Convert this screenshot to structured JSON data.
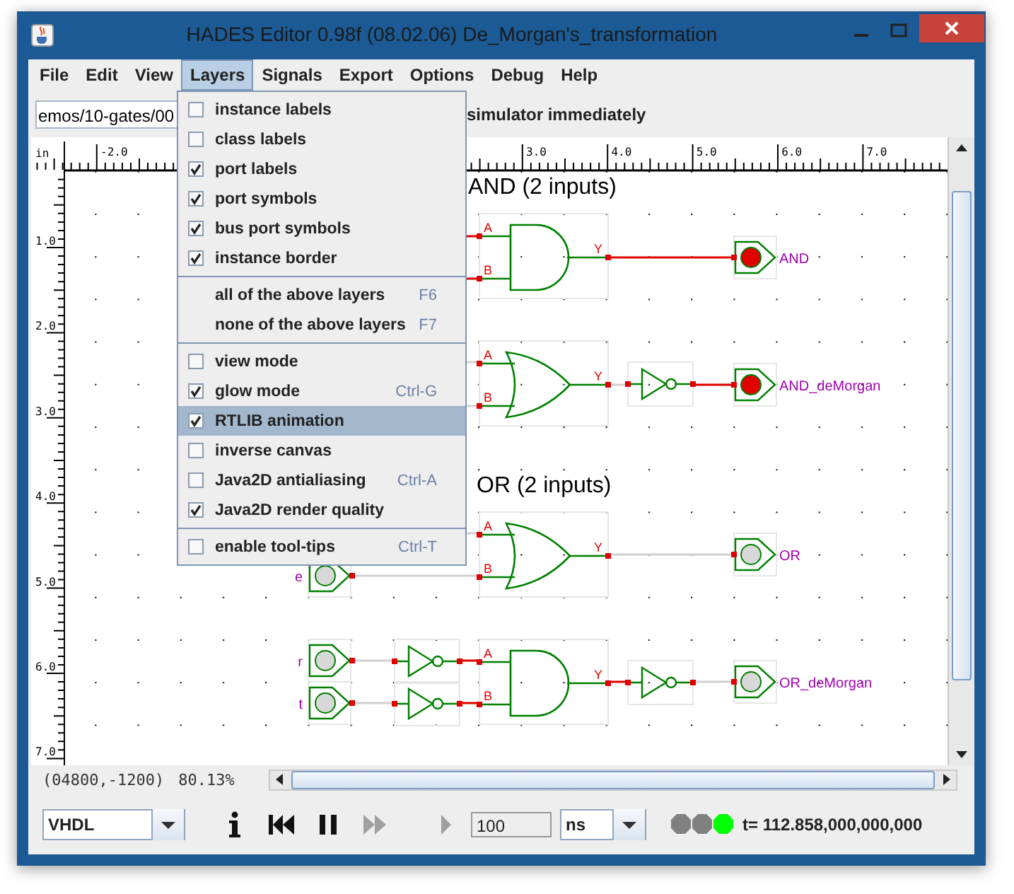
{
  "window": {
    "title": "HADES Editor 0.98f (08.02.06)   De_Morgan's_transformation"
  },
  "menu_bar": [
    {
      "label": "File",
      "selected": false
    },
    {
      "label": "Edit",
      "selected": false
    },
    {
      "label": "View",
      "selected": false
    },
    {
      "label": "Layers",
      "selected": true
    },
    {
      "label": "Signals",
      "selected": false
    },
    {
      "label": "Export",
      "selected": false
    },
    {
      "label": "Options",
      "selected": false
    },
    {
      "label": "Debug",
      "selected": false
    },
    {
      "label": "Help",
      "selected": false
    }
  ],
  "toolbar": {
    "path": "emos/10-gates/00",
    "message": "simulator immediately"
  },
  "layers_menu": [
    [
      {
        "kind": "check",
        "label": "instance labels",
        "checked": false,
        "selected": false
      },
      {
        "kind": "check",
        "label": "class labels",
        "checked": false,
        "selected": false
      },
      {
        "kind": "check",
        "label": "port labels",
        "checked": true,
        "selected": false
      },
      {
        "kind": "check",
        "label": "port symbols",
        "checked": true,
        "selected": false
      },
      {
        "kind": "check",
        "label": "bus port symbols",
        "checked": true,
        "selected": false
      },
      {
        "kind": "check",
        "label": "instance border",
        "checked": true,
        "selected": false
      }
    ],
    [
      {
        "kind": "action",
        "label": "all of the above layers",
        "shortcut": "F6",
        "selected": false
      },
      {
        "kind": "action",
        "label": "none of the above layers",
        "shortcut": "F7",
        "selected": false
      }
    ],
    [
      {
        "kind": "check",
        "label": "view mode",
        "checked": false,
        "selected": false
      },
      {
        "kind": "check",
        "label": "glow mode",
        "checked": true,
        "shortcut": "Ctrl-G",
        "selected": false
      },
      {
        "kind": "check",
        "label": "RTLIB animation",
        "checked": true,
        "selected": true
      },
      {
        "kind": "check",
        "label": "inverse canvas",
        "checked": false,
        "selected": false
      },
      {
        "kind": "check",
        "label": "Java2D antialiasing",
        "checked": false,
        "shortcut": "Ctrl-A",
        "selected": false
      },
      {
        "kind": "check",
        "label": "Java2D render quality",
        "checked": true,
        "selected": false
      }
    ],
    [
      {
        "kind": "check",
        "label": "enable tool-tips",
        "checked": false,
        "shortcut": "Ctrl-T",
        "selected": false
      }
    ]
  ],
  "canvas": {
    "ruler_unit": "in",
    "top_ruler": [
      "-2.0",
      "3.0",
      "4.0",
      "5.0",
      "6.0",
      "7.0"
    ],
    "left_ruler": [
      "1.0",
      "2.0",
      "3.0",
      "4.0",
      "5.0",
      "6.0",
      "7.0"
    ],
    "titles": [
      "AND (2 inputs)",
      "OR (2 inputs)"
    ],
    "gates": [
      {
        "kind": "and",
        "ports": [
          "A",
          "B",
          "Y"
        ]
      },
      {
        "kind": "or",
        "ports": [
          "A",
          "B",
          "Y"
        ]
      },
      {
        "kind": "or",
        "ports": [
          "A",
          "B",
          "Y"
        ]
      },
      {
        "kind": "and",
        "ports": [
          "A",
          "B",
          "Y"
        ]
      }
    ],
    "inputs": [
      {
        "label": "e",
        "on": false
      },
      {
        "label": "r",
        "on": false
      },
      {
        "label": "t",
        "on": false
      }
    ],
    "outputs": [
      {
        "label": "AND",
        "on": true
      },
      {
        "label": "AND_deMorgan",
        "on": true
      },
      {
        "label": "OR",
        "on": false
      },
      {
        "label": "OR_deMorgan",
        "on": false
      }
    ]
  },
  "status_bar": {
    "coordinates": "(04800,-1200)",
    "zoom": "80.13%"
  },
  "controls": {
    "language": "VHDL",
    "buttons": [
      {
        "kind": "info",
        "disabled": false
      },
      {
        "kind": "rewind",
        "disabled": false
      },
      {
        "kind": "pause",
        "disabled": false
      },
      {
        "kind": "forward",
        "disabled": true
      },
      {
        "kind": "step",
        "disabled": true
      }
    ],
    "step_value": "100",
    "unit": "ns",
    "status_lights": [
      {
        "color": "#808080"
      },
      {
        "color": "#808080"
      },
      {
        "color": "#00ff00"
      }
    ],
    "time": "t= 112.858,000,000,000"
  }
}
